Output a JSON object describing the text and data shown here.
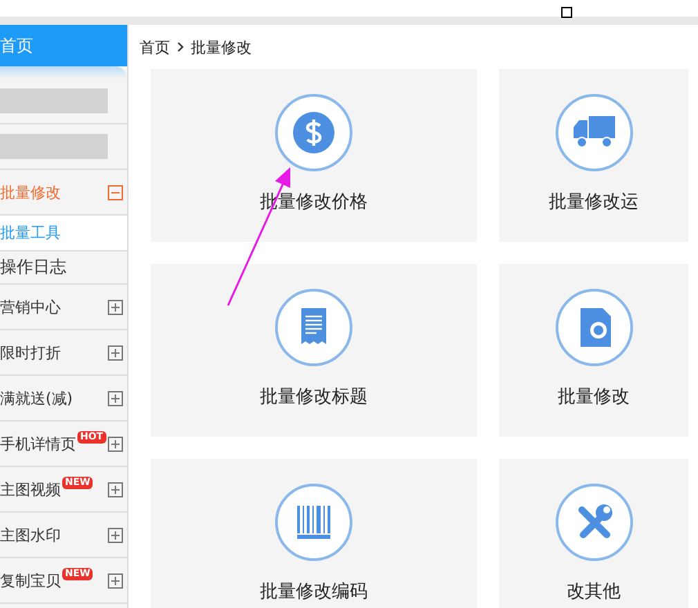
{
  "sidebar": {
    "header": {
      "label": "首页",
      "selected": true
    },
    "items": [
      {
        "kind": "blurred"
      },
      {
        "kind": "blurred"
      },
      {
        "kind": "group",
        "label": "批量修改",
        "expanded": true
      },
      {
        "kind": "link",
        "label": "批量工具",
        "selected": true
      },
      {
        "kind": "plain",
        "label": "操作日志"
      },
      {
        "kind": "group",
        "label": "营销中心",
        "expanded": false
      },
      {
        "kind": "group",
        "label": "限时打折",
        "expanded": false
      },
      {
        "kind": "group",
        "label": "满就送(减)",
        "expanded": false
      },
      {
        "kind": "group",
        "label": "手机详情页",
        "badge": "HOT",
        "expanded": false
      },
      {
        "kind": "group",
        "label": "主图视频",
        "badge": "NEW",
        "expanded": false
      },
      {
        "kind": "group",
        "label": "主图水印",
        "expanded": false
      },
      {
        "kind": "group",
        "label": "复制宝贝",
        "badge": "NEW",
        "expanded": false
      }
    ]
  },
  "breadcrumb": [
    "首页",
    "批量修改"
  ],
  "tiles": [
    {
      "kind": "price",
      "label": "批量修改价格"
    },
    {
      "kind": "shipping",
      "label": "批量修改运"
    },
    {
      "kind": "title",
      "label": "批量修改标题"
    },
    {
      "kind": "search",
      "label": "批量修改"
    },
    {
      "kind": "barcode",
      "label": "批量修改编码"
    },
    {
      "kind": "tools",
      "label": "改其他"
    }
  ]
}
